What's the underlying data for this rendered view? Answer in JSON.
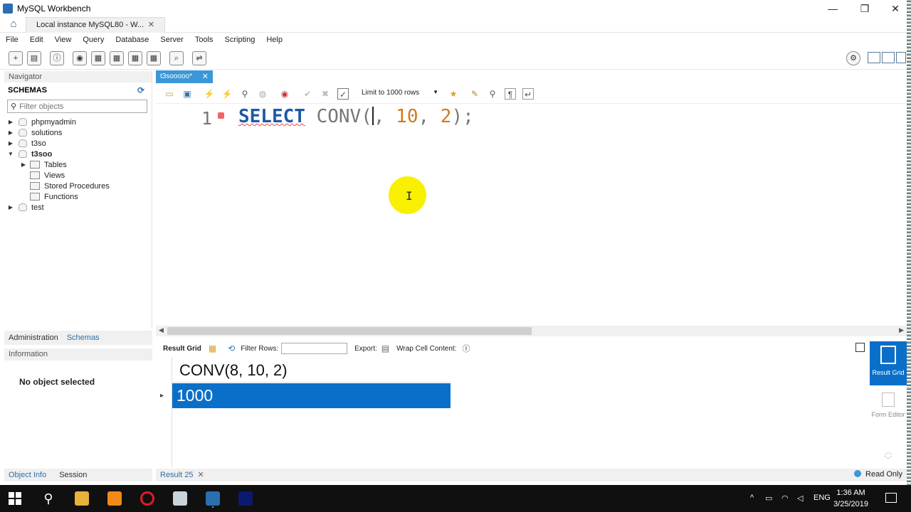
{
  "window": {
    "title": "MySQL Workbench",
    "minimize": "—",
    "maximize": "❐",
    "close": "✕"
  },
  "connection_tab": {
    "label": "Local instance MySQL80 - W...",
    "close": "✕"
  },
  "menu": [
    "File",
    "Edit",
    "View",
    "Query",
    "Database",
    "Server",
    "Tools",
    "Scripting",
    "Help"
  ],
  "navigator": {
    "header": "Navigator",
    "schemas_title": "SCHEMAS",
    "filter_placeholder": "Filter objects",
    "schemas": [
      {
        "name": "phpmyadmin",
        "expanded": false
      },
      {
        "name": "solutions",
        "expanded": false
      },
      {
        "name": "t3so",
        "expanded": false
      },
      {
        "name": "t3soo",
        "expanded": true,
        "children": [
          "Tables",
          "Views",
          "Stored Procedures",
          "Functions"
        ]
      },
      {
        "name": "test",
        "expanded": false
      }
    ]
  },
  "nav_bottom_tabs": {
    "administration": "Administration",
    "schemas": "Schemas"
  },
  "information": {
    "header": "Information",
    "empty": "No object selected"
  },
  "objinfo_tabs": {
    "object_info": "Object Info",
    "session": "Session"
  },
  "editor": {
    "tab_label": "t3sooooo*",
    "tab_close": "✕",
    "limit_label": "Limit to 1000 rows",
    "line_number": "1",
    "code": {
      "keyword": "SELECT",
      "function": "CONV(",
      "after_cursor": ", ",
      "arg2": "10",
      "sep": ", ",
      "arg3": "2",
      "end": ");"
    }
  },
  "result_toolbar": {
    "result_grid": "Result Grid",
    "filter_rows": "Filter Rows:",
    "export": "Export:",
    "wrap": "Wrap Cell Content:"
  },
  "result_grid": {
    "columns": [
      "CONV(8, 10, 2)"
    ],
    "rows": [
      [
        "1000"
      ]
    ]
  },
  "side_panel": {
    "result_grid": "Result Grid",
    "form_editor": "Form Editor"
  },
  "result_tabs": {
    "tab": "Result 25",
    "status": "Read Only"
  },
  "taskbar": {
    "time": "1:36 AM",
    "date": "3/25/2019",
    "language": "ENG"
  }
}
